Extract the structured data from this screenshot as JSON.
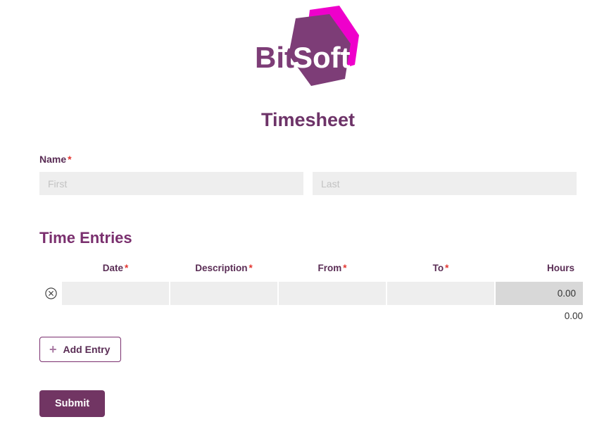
{
  "brand": {
    "name_part1": "Bit",
    "name_part2": "Soft",
    "purple": "#7d3d77",
    "magenta": "#ef00cb"
  },
  "header": {
    "title": "Timesheet"
  },
  "name_field": {
    "label": "Name",
    "required_marker": "*",
    "first": {
      "placeholder": "First",
      "value": ""
    },
    "last": {
      "placeholder": "Last",
      "value": ""
    }
  },
  "time_entries": {
    "section_title": "Time Entries",
    "required_marker": "*",
    "columns": [
      {
        "key": "remove",
        "label": "",
        "required": false
      },
      {
        "key": "date",
        "label": "Date",
        "required": true
      },
      {
        "key": "description",
        "label": "Description",
        "required": true
      },
      {
        "key": "from",
        "label": "From",
        "required": true
      },
      {
        "key": "to",
        "label": "To",
        "required": true
      },
      {
        "key": "hours",
        "label": "Hours",
        "required": false
      }
    ],
    "rows": [
      {
        "remove_icon": "remove-circle-icon",
        "date": "",
        "description": "",
        "from": "",
        "to": "",
        "hours": "0.00"
      }
    ],
    "total": "0.00"
  },
  "add_entry": {
    "icon": "plus-icon",
    "label": "Add Entry"
  },
  "submit": {
    "label": "Submit"
  }
}
